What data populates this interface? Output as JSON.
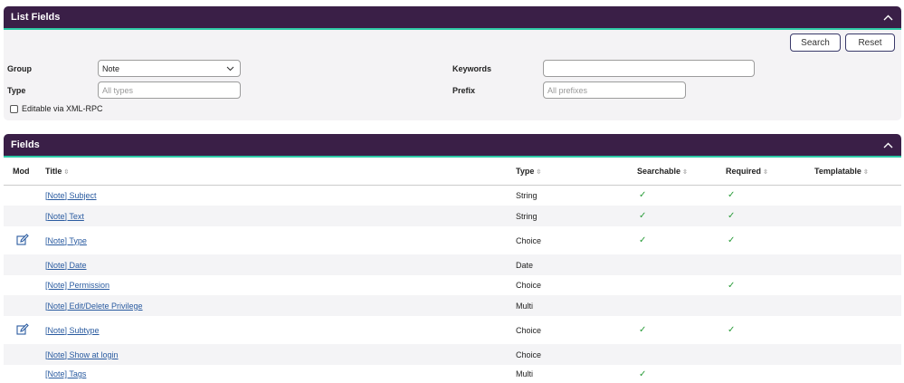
{
  "filter_panel": {
    "title": "List Fields",
    "search_label": "Search",
    "reset_label": "Reset",
    "group_label": "Group",
    "group_value": "Note",
    "type_label": "Type",
    "type_placeholder": "All types",
    "keywords_label": "Keywords",
    "keywords_value": "",
    "prefix_label": "Prefix",
    "prefix_placeholder": "All prefixes",
    "editable_label": "Editable via XML-RPC"
  },
  "fields_panel": {
    "title": "Fields",
    "columns": [
      "Mod",
      "Title",
      "Type",
      "Searchable",
      "Required",
      "Templatable"
    ],
    "rows": [
      {
        "mod": false,
        "title": "[Note] Subject",
        "type": "String",
        "searchable": true,
        "required": true,
        "templatable": false
      },
      {
        "mod": false,
        "title": "[Note] Text",
        "type": "String",
        "searchable": true,
        "required": true,
        "templatable": false
      },
      {
        "mod": true,
        "title": "[Note] Type",
        "type": "Choice",
        "searchable": true,
        "required": true,
        "templatable": false
      },
      {
        "mod": false,
        "title": "[Note] Date",
        "type": "Date",
        "searchable": false,
        "required": false,
        "templatable": false
      },
      {
        "mod": false,
        "title": "[Note] Permission",
        "type": "Choice",
        "searchable": false,
        "required": true,
        "templatable": false
      },
      {
        "mod": false,
        "title": "[Note] Edit/Delete Privilege",
        "type": "Multi",
        "searchable": false,
        "required": false,
        "templatable": false
      },
      {
        "mod": true,
        "title": "[Note] Subtype",
        "type": "Choice",
        "searchable": true,
        "required": true,
        "templatable": false
      },
      {
        "mod": false,
        "title": "[Note] Show at login",
        "type": "Choice",
        "searchable": false,
        "required": false,
        "templatable": false
      },
      {
        "mod": false,
        "title": "[Note] Tags",
        "type": "Multi",
        "searchable": true,
        "required": false,
        "templatable": false
      }
    ],
    "check_glyph": "✓"
  },
  "colors": {
    "header_bg": "#3a1f47",
    "header_accent": "#2ec9a6",
    "link": "#2a5ba0",
    "check": "#2a9c3a",
    "edit_icon": "#2a5ba0"
  }
}
